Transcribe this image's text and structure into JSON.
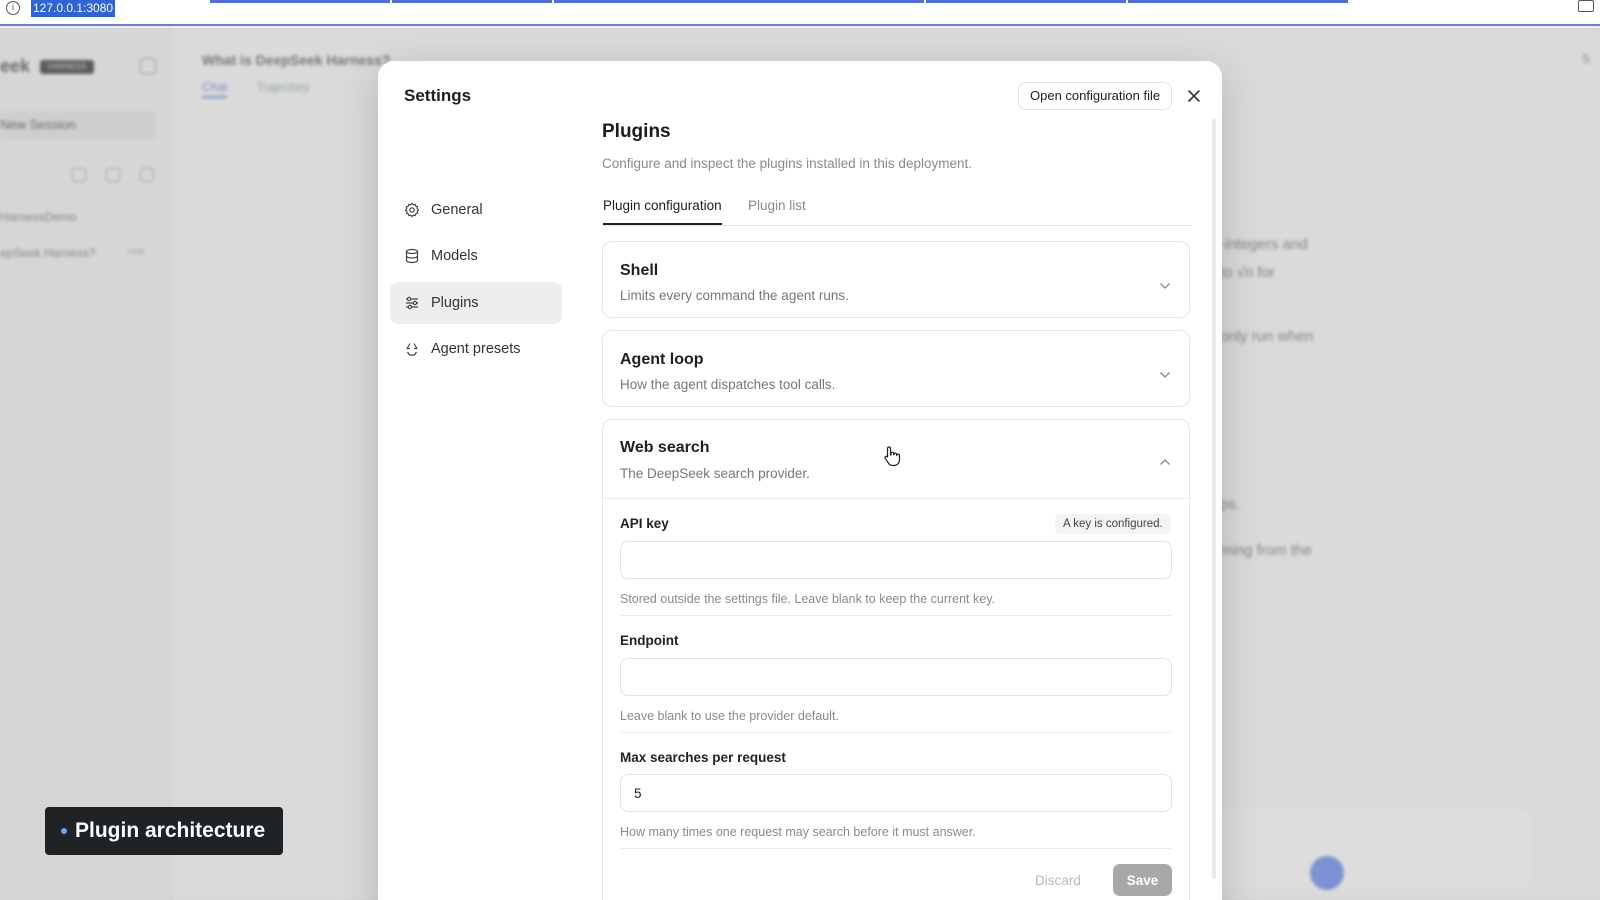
{
  "browser": {
    "url": "127.0.0.1:3080"
  },
  "background_app": {
    "brand_fragment": "eek",
    "brand_badge": "HARNESS",
    "new_session": "New Session",
    "session_group": "HarnessDemo",
    "session_item": "epSeek Harness?",
    "session_item_tag": "now",
    "chat_title": "What is DeepSeek Harness?",
    "chat_tabs": [
      "Chat",
      "Trajectory"
    ],
    "text_fragments": [
      "-integers and",
      "to √n for",
      "only run when",
      "ps.",
      "ming from the"
    ],
    "right_edge_text": "S"
  },
  "settings": {
    "title": "Settings",
    "nav": [
      {
        "label": "General",
        "icon": "gear-icon"
      },
      {
        "label": "Models",
        "icon": "database-icon"
      },
      {
        "label": "Plugins",
        "icon": "sliders-icon"
      },
      {
        "label": "Agent presets",
        "icon": "recycle-icon"
      }
    ],
    "active_nav": "Plugins",
    "open_config_label": "Open configuration file",
    "plugins": {
      "title": "Plugins",
      "description": "Configure and inspect the plugins installed in this deployment.",
      "tabs": [
        "Plugin configuration",
        "Plugin list"
      ],
      "active_tab": "Plugin configuration",
      "cards": [
        {
          "title": "Shell",
          "subtitle": "Limits every command the agent runs.",
          "expanded": false
        },
        {
          "title": "Agent loop",
          "subtitle": "How the agent dispatches tool calls.",
          "expanded": false
        },
        {
          "title": "Web search",
          "subtitle": "The DeepSeek search provider.",
          "expanded": true
        }
      ],
      "web_search": {
        "api_key_label": "API key",
        "api_key_status": "A key is configured.",
        "api_key_value": "",
        "api_key_help": "Stored outside the settings file. Leave blank to keep the current key.",
        "endpoint_label": "Endpoint",
        "endpoint_value": "",
        "endpoint_help": "Leave blank to use the provider default.",
        "max_searches_label": "Max searches per request",
        "max_searches_value": "5",
        "max_searches_help": "How many times one request may search before it must answer.",
        "discard_label": "Discard",
        "save_label": "Save"
      }
    }
  },
  "caption": {
    "text": "Plugin architecture"
  }
}
